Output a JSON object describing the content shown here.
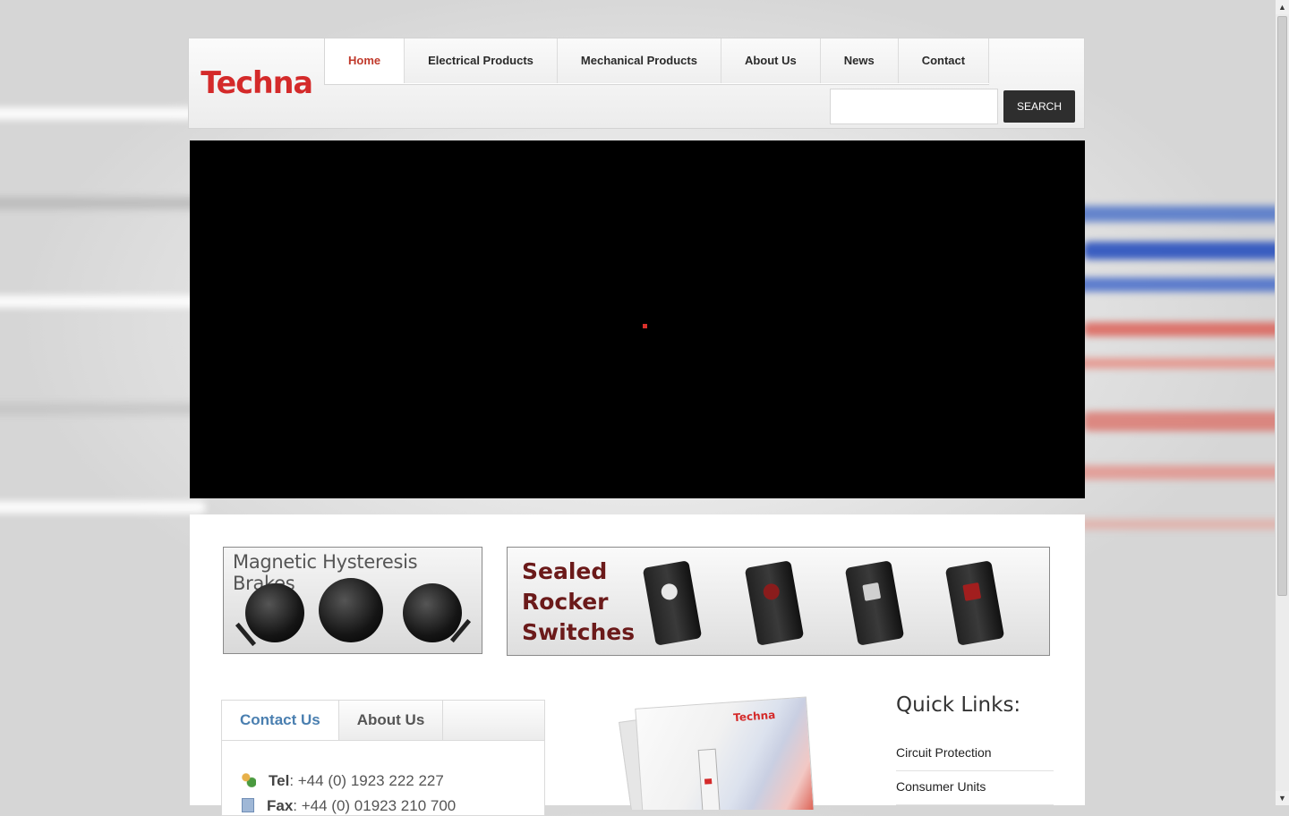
{
  "logo": {
    "text": "Techna"
  },
  "nav": {
    "items": [
      {
        "label": "Home",
        "active": true
      },
      {
        "label": "Electrical Products",
        "active": false
      },
      {
        "label": "Mechanical Products",
        "active": false
      },
      {
        "label": "About Us",
        "active": false
      },
      {
        "label": "News",
        "active": false
      },
      {
        "label": "Contact",
        "active": false
      }
    ]
  },
  "search": {
    "value": "",
    "button_label": "SEARCH"
  },
  "banners": {
    "brakes_title": "Magnetic Hysteresis Brakes",
    "rocker_title_line1": "Sealed",
    "rocker_title_line2": "Rocker",
    "rocker_title_line3": "Switches"
  },
  "tabs": [
    {
      "label": "Contact Us",
      "active": true
    },
    {
      "label": "About Us",
      "active": false
    }
  ],
  "contact": {
    "tel_label": "Tel",
    "tel_value": ": +44 (0) 1923 222 227",
    "fax_label": "Fax",
    "fax_value": ": +44 (0) 01923 210 700"
  },
  "brochure": {
    "logo_text": "Techna"
  },
  "quick_links": {
    "title": "Quick Links:",
    "items": [
      "Circuit Protection",
      "Consumer Units"
    ]
  },
  "colors": {
    "brand_red": "#d42a2a",
    "nav_active": "#c0392b",
    "tab_active": "#4a7fb0",
    "banner_title": "#6b1a1a"
  }
}
